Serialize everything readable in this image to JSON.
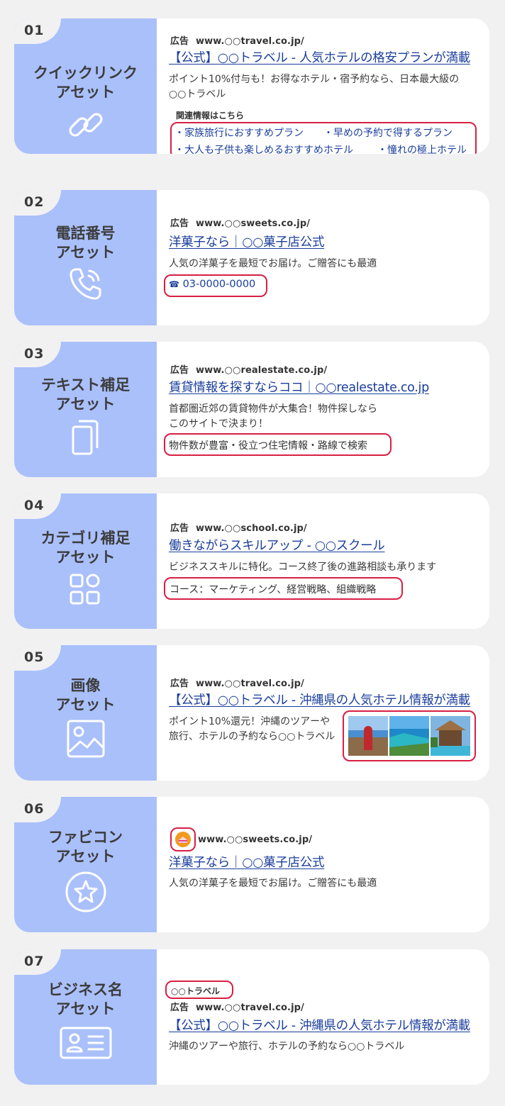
{
  "cards": [
    {
      "number": "01",
      "title": "クイックリンク\nアセット",
      "icon": "link-icon",
      "ad_tag": "広告",
      "url": "www.○○travel.co.jp/",
      "headline": "【公式】○○トラベル - 人気ホテルの格安プランが満載",
      "description": "ポイント10%付与も！お得なホテル・宿予約なら、日本最大級の\n○○トラベル",
      "related_label": "関連情報はこちら",
      "links": [
        "・家族旅行におすすめプラン",
        "・早めの予約で得するプラン",
        "・大人も子供も楽しめるおすすめホテル",
        "・憧れの極上ホテル"
      ]
    },
    {
      "number": "02",
      "title": "電話番号\nアセット",
      "icon": "phone-icon",
      "ad_tag": "広告",
      "url": "www.○○sweets.co.jp/",
      "headline": "洋菓子なら｜○○菓子店公式",
      "description": "人気の洋菓子を最短でお届け。ご贈答にも最適",
      "phone_glyph": "☎",
      "phone": "03-0000-0000"
    },
    {
      "number": "03",
      "title": "テキスト補足\nアセット",
      "icon": "copy-icon",
      "ad_tag": "広告",
      "url": "www.○○realestate.co.jp/",
      "headline": "賃貸情報を探すならココ｜○○realestate.co.jp",
      "description": "首都圏近郊の賃貸物件が大集合！物件探しなら\nこのサイトで決まり！",
      "callout": "物件数が豊富・役立つ住宅情報・路線で検索"
    },
    {
      "number": "04",
      "title": "カテゴリ補足\nアセット",
      "icon": "category-grid-icon",
      "ad_tag": "広告",
      "url": "www.○○school.co.jp/",
      "headline": "働きながらスキルアップ - ○○スクール",
      "description": "ビジネススキルに特化。コース終了後の進路相談も承ります",
      "snippet": "コース：マーケティング、経営戦略、組織戦略"
    },
    {
      "number": "05",
      "title": "画像\nアセット",
      "icon": "image-icon",
      "ad_tag": "広告",
      "url": "www.○○travel.co.jp/",
      "headline": "【公式】○○トラベル - 沖縄県の人気ホテル情報が満載",
      "description": "ポイント10%還元！沖縄のツアーや\n旅行、ホテルの予約なら○○トラベル"
    },
    {
      "number": "06",
      "title": "ファビコン\nアセット",
      "icon": "star-circle-icon",
      "url": "www.○○sweets.co.jp/",
      "headline": "洋菓子なら｜○○菓子店公式",
      "description": "人気の洋菓子を最短でお届け。ご贈答にも最適"
    },
    {
      "number": "07",
      "title": "ビジネス名\nアセット",
      "icon": "id-card-icon",
      "business_name": "○○トラベル",
      "ad_tag": "広告",
      "url": "www.○○travel.co.jp/",
      "headline": "【公式】○○トラベル - 沖縄県の人気ホテル情報が満載",
      "description": "沖縄のツアーや旅行、ホテルの予約なら○○トラベル"
    }
  ],
  "colors": {
    "page_bg": "#f1f1f2",
    "panel_blue": "#aac0fb",
    "link_blue": "#1a3d9c",
    "highlight_red": "#d81f43"
  }
}
